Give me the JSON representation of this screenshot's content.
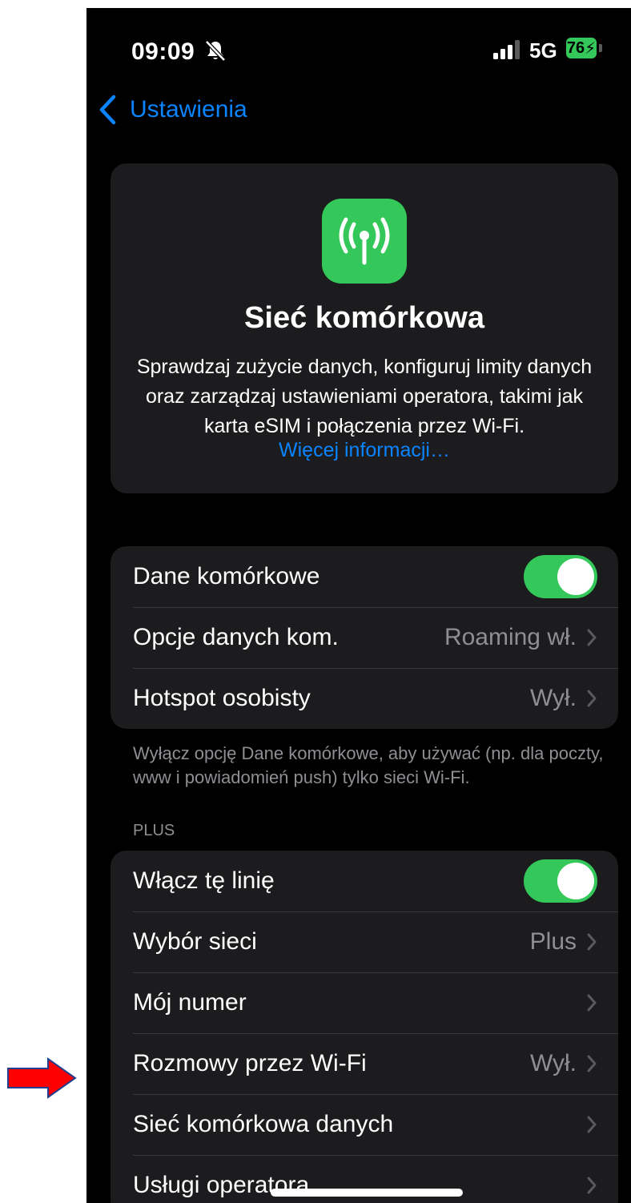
{
  "status_bar": {
    "time": "09:09",
    "network": "5G",
    "battery": "76",
    "icons": [
      "bell-slash-icon",
      "signal-bars-icon",
      "battery-charging-icon"
    ]
  },
  "nav": {
    "back_label": "Ustawienia"
  },
  "header": {
    "icon": "antenna-radiowaves-icon",
    "title": "Sieć komórkowa",
    "description": "Sprawdzaj zużycie danych, konfiguruj limity danych oraz zarządzaj ustawieniami operatora, takimi jak karta eSIM i połączenia przez Wi-Fi.",
    "link": "Więcej informacji…"
  },
  "group1": {
    "rows": [
      {
        "label": "Dane komórkowe",
        "toggle": true
      },
      {
        "label": "Opcje danych kom.",
        "value": "Roaming wł."
      },
      {
        "label": "Hotspot osobisty",
        "value": "Wył."
      }
    ],
    "footnote": "Wyłącz opcję Dane komórkowe, aby używać (np. dla poczty, www i powiadomień push) tylko sieci Wi-Fi."
  },
  "group2": {
    "header": "PLUS",
    "rows": [
      {
        "label": "Włącz tę linię",
        "toggle": true
      },
      {
        "label": "Wybór sieci",
        "value": "Plus"
      },
      {
        "label": "Mój numer",
        "value": ""
      },
      {
        "label": "Rozmowy przez Wi-Fi",
        "value": "Wył."
      },
      {
        "label": "Sieć komórkowa danych",
        "value": ""
      },
      {
        "label": "Usługi operatora",
        "value": ""
      }
    ]
  },
  "colors": {
    "accent": "#0a84ff",
    "toggle_on": "#34c759",
    "background": "#000000",
    "card": "#1c1c1e",
    "secondary_text": "#8e8e93",
    "annotation_arrow": "#ff0000"
  }
}
